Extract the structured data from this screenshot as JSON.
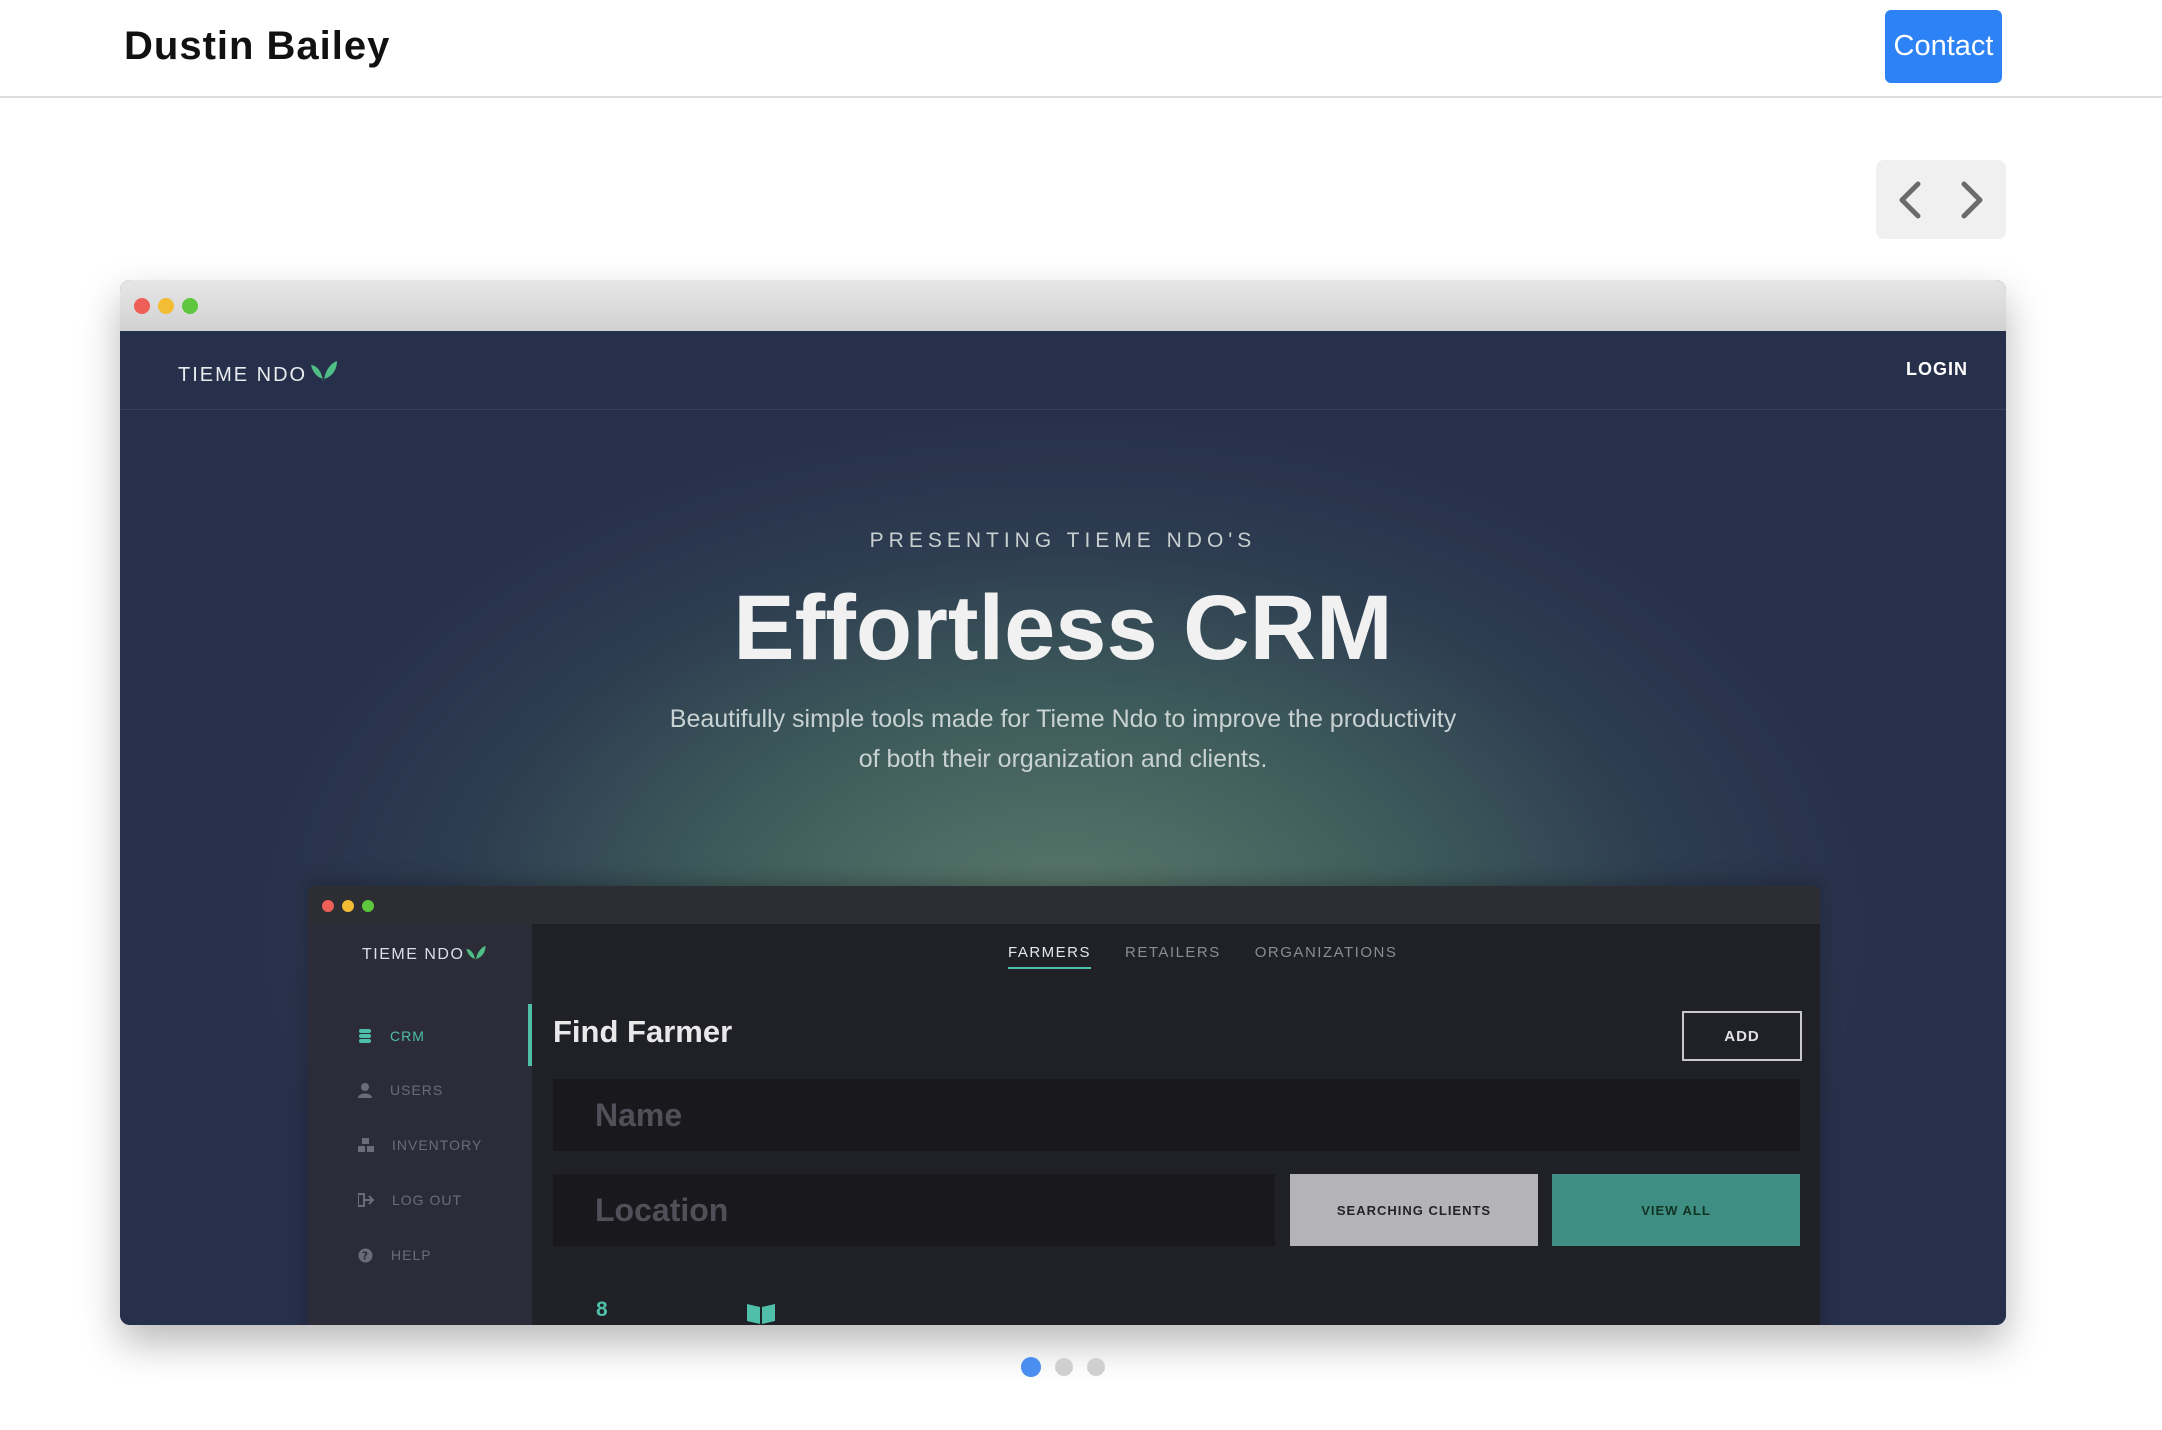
{
  "header": {
    "brand": "Dustin Bailey",
    "contact_label": "Contact"
  },
  "carousel": {
    "prev_icon": "chevron-left-icon",
    "next_icon": "chevron-right-icon",
    "slide_count": 3,
    "active_index": 0
  },
  "slide": {
    "nav": {
      "logo": "TIEME NDO",
      "login": "LOGIN"
    },
    "eyebrow": "PRESENTING TIEME NDO'S",
    "headline": "Effortless CRM",
    "subtitle": "Beautifully simple tools made for Tieme Ndo to improve the productivity of both their organization and clients.",
    "app": {
      "logo": "TIEME NDO",
      "sidebar": [
        {
          "label": "CRM",
          "icon": "database-icon",
          "active": true
        },
        {
          "label": "USERS",
          "icon": "user-icon",
          "active": false
        },
        {
          "label": "INVENTORY",
          "icon": "boxes-icon",
          "active": false
        },
        {
          "label": "LOG OUT",
          "icon": "logout-icon",
          "active": false
        },
        {
          "label": "HELP",
          "icon": "help-icon",
          "active": false
        }
      ],
      "tabs": [
        "FARMERS",
        "RETAILERS",
        "ORGANIZATIONS"
      ],
      "title": "Find Farmer",
      "add_label": "ADD",
      "name_placeholder": "Name",
      "location_placeholder": "Location",
      "search_label": "SEARCHING CLIENTS",
      "view_all_label": "VIEW ALL",
      "stat": "8"
    }
  },
  "colors": {
    "accent": "#2d82f5",
    "teal": "#4fbfaa",
    "pager_active": "#4a8ef0"
  }
}
